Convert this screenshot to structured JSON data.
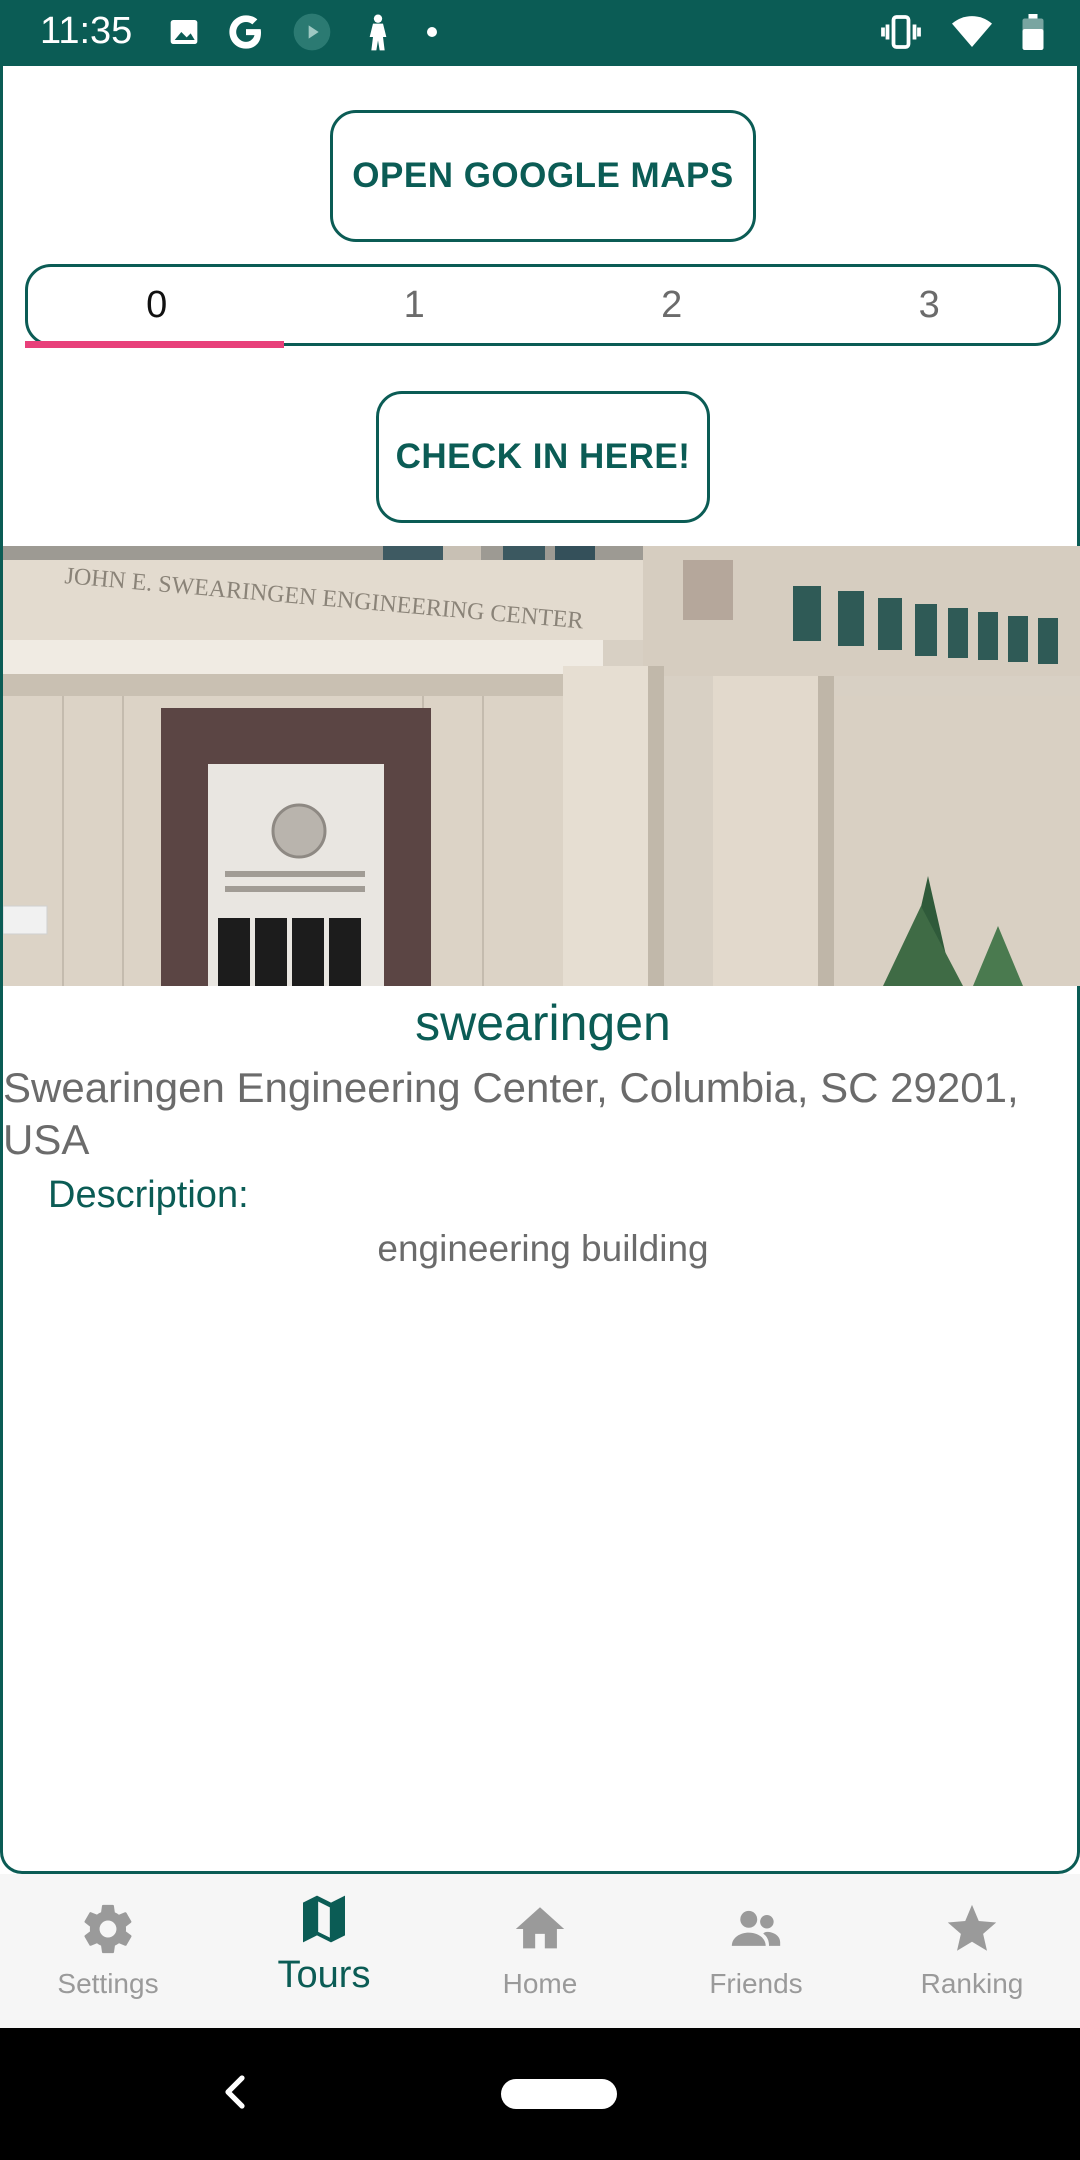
{
  "status_bar": {
    "time": "11:35",
    "left_icons": [
      "image-icon",
      "google-g-icon",
      "play-icon",
      "figure-icon",
      "dot-icon"
    ],
    "right_icons": [
      "vibrate-icon",
      "wifi-icon",
      "battery-icon"
    ]
  },
  "actions": {
    "open_maps_label": "OPEN GOOGLE MAPS",
    "check_in_label": "CHECK IN HERE!"
  },
  "tabs": {
    "items": [
      "0",
      "1",
      "2",
      "3"
    ],
    "selected": "0"
  },
  "place": {
    "photo_icon": "building-photo",
    "photo_text": "JOHN E. SWEARINGEN ENGINEERING CENTER",
    "name": "swearingen",
    "address": "Swearingen Engineering Center, Columbia, SC 29201, USA",
    "description_label": "Description:",
    "description": "engineering building"
  },
  "bottom_nav": {
    "items": [
      {
        "label": "Settings",
        "icon": "gear-icon"
      },
      {
        "label": "Tours",
        "icon": "map-icon"
      },
      {
        "label": "Home",
        "icon": "home-icon"
      },
      {
        "label": "Friends",
        "icon": "people-icon"
      },
      {
        "label": "Ranking",
        "icon": "star-icon"
      }
    ],
    "active": "Tours"
  },
  "system_nav": {
    "icons": [
      "back-icon",
      "home-pill-icon"
    ]
  },
  "colors": {
    "primary": "#0b5c55",
    "accent": "#e8407a",
    "muted_text": "#6b6b6b",
    "nav_background": "#f6f6f6"
  }
}
